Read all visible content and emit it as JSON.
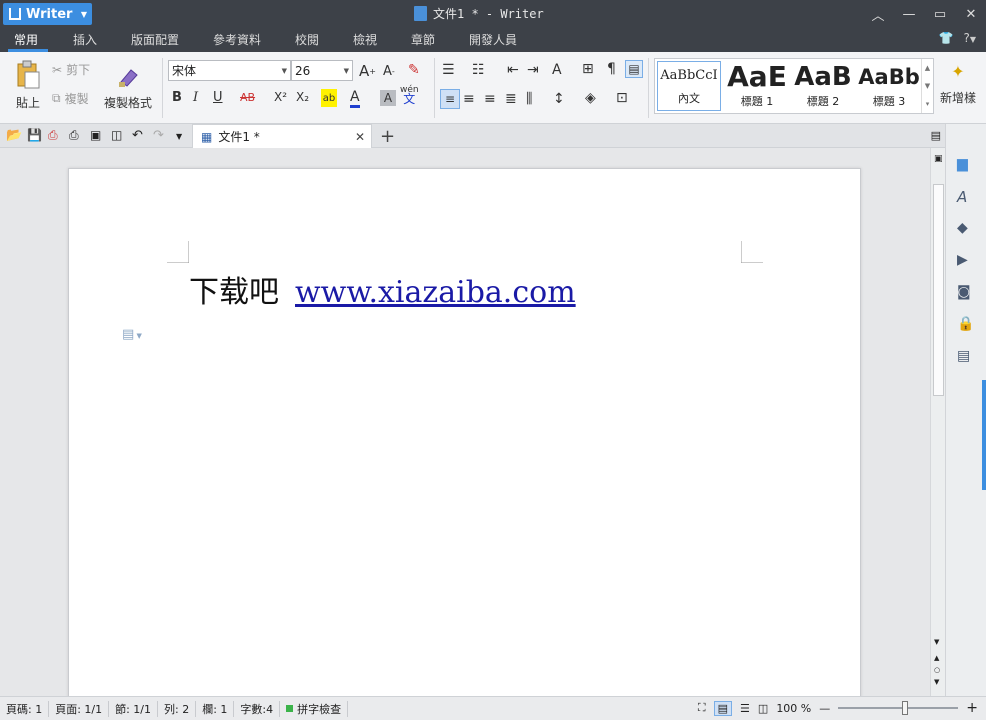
{
  "app": {
    "name": "Writer",
    "window_title": "文件1 * - Writer"
  },
  "menu": {
    "tabs": [
      "常用",
      "插入",
      "版面配置",
      "參考資料",
      "校閱",
      "檢視",
      "章節",
      "開發人員"
    ],
    "active": "常用",
    "help": "?"
  },
  "ribbon": {
    "paste": "貼上",
    "cut": "剪下",
    "copy": "複製",
    "format_painter": "複製格式",
    "font_name": "宋体",
    "font_size": "26",
    "bold": "B",
    "italic": "I",
    "underline": "U",
    "strike": "AB",
    "superscript": "X²",
    "subscript": "X₂",
    "font_color": "A",
    "char_shading": "A",
    "phonetic": "文",
    "phonetic_top": "wén",
    "styles": [
      {
        "preview": "AaBbCcI",
        "label": "內文"
      },
      {
        "preview": "AaE",
        "label": "標題 1"
      },
      {
        "preview": "AaB",
        "label": "標題 2"
      },
      {
        "preview": "AaBb",
        "label": "標題 3"
      }
    ],
    "new_style": "新增樣"
  },
  "tabbar": {
    "doc_tab": "文件1 *",
    "close": "✕",
    "add": "+"
  },
  "document": {
    "text": "下载吧",
    "link": "www.xiazaiba.com"
  },
  "status": {
    "page_no": "頁碼: 1",
    "pages": "頁面: 1/1",
    "section": "節: 1/1",
    "row": "列: 2",
    "col": "欄: 1",
    "words": "字數:4",
    "spell": "拼字檢查",
    "zoom": "100 %",
    "zoom_minus": "—",
    "zoom_plus": "+"
  },
  "colors": {
    "title_bg": "#3d4148",
    "accent": "#3c8ee0",
    "link": "#1a1aa6"
  }
}
